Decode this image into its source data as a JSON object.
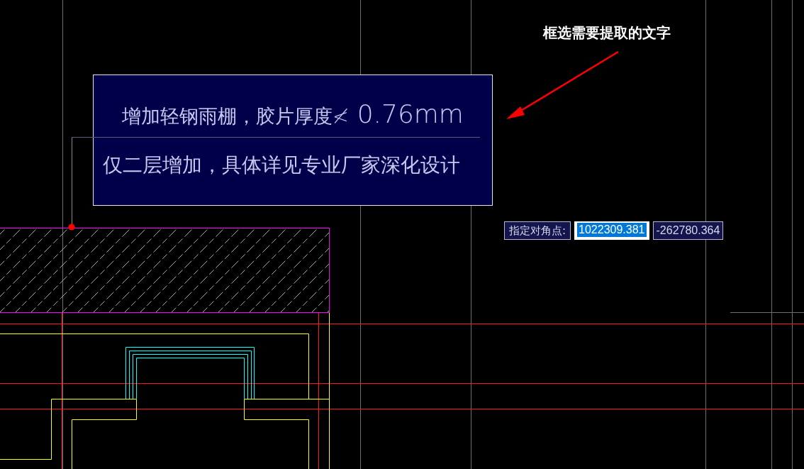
{
  "annotation": {
    "text": "框选需要提取的文字"
  },
  "selection_box": {
    "lines": [
      {
        "parts": [
          "增加轻钢雨棚，胶片厚度≮",
          "0.76mm"
        ]
      },
      {
        "parts": [
          "仅二层增加，具体详见专业厂家深化设计"
        ]
      }
    ]
  },
  "prompt": {
    "label": "指定对角点:",
    "fields": [
      {
        "value": "1022309.381",
        "selected": true
      },
      {
        "value": "-262780.364",
        "selected": false
      }
    ]
  }
}
